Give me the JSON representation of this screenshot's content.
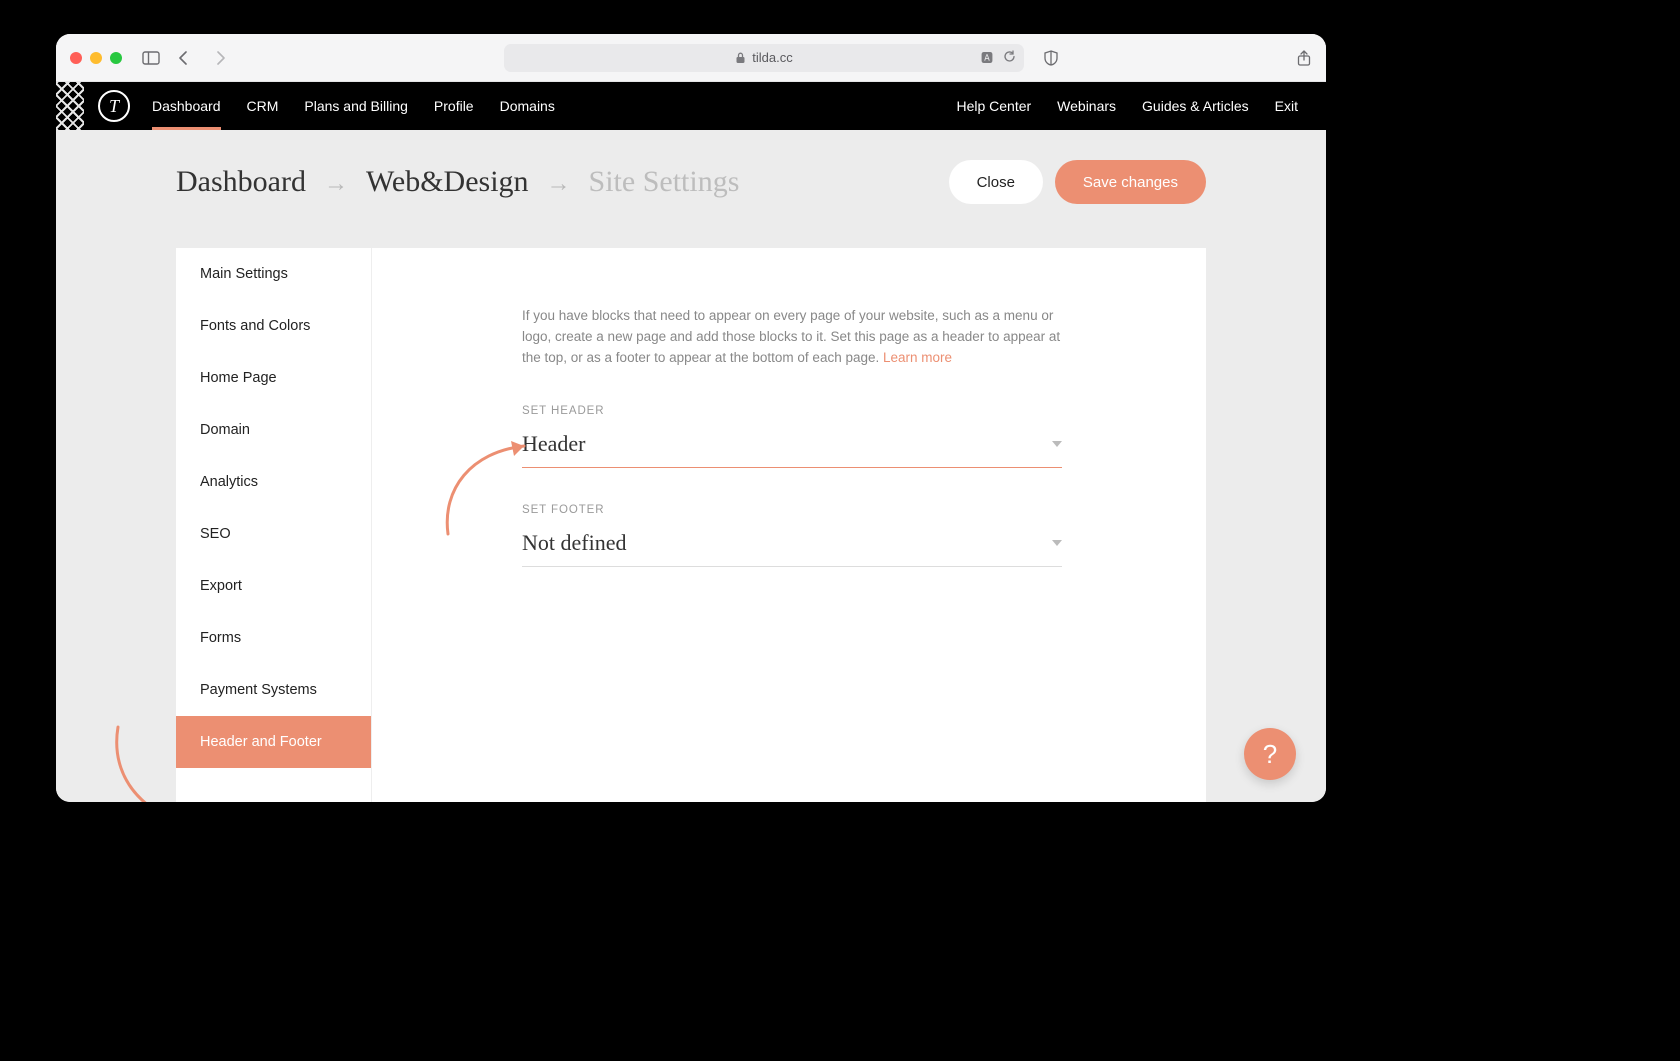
{
  "browser": {
    "url_host": "tilda.cc"
  },
  "topnav": {
    "logo_letter": "T",
    "left": [
      "Dashboard",
      "CRM",
      "Plans and Billing",
      "Profile",
      "Domains"
    ],
    "left_active_index": 0,
    "right": [
      "Help Center",
      "Webinars",
      "Guides & Articles",
      "Exit"
    ]
  },
  "breadcrumbs": {
    "items": [
      "Dashboard",
      "Web&Design",
      "Site Settings"
    ],
    "sep": "→"
  },
  "actions": {
    "close": "Close",
    "save": "Save changes"
  },
  "sidebar": {
    "items": [
      "Main Settings",
      "Fonts and Colors",
      "Home Page",
      "Domain",
      "Analytics",
      "SEO",
      "Export",
      "Forms",
      "Payment Systems",
      "Header and Footer"
    ],
    "active_index": 9
  },
  "panel": {
    "help_text": "If you have blocks that need to appear on every page of your website, such as a menu or logo, create a new page and add those blocks to it. Set this page as a header to appear at the top, or as a footer to appear at the bottom of each page. ",
    "learn_more": "Learn more",
    "fields": {
      "header": {
        "label": "SET HEADER",
        "value": "Header"
      },
      "footer": {
        "label": "SET FOOTER",
        "value": "Not defined"
      }
    }
  },
  "fab": "?"
}
